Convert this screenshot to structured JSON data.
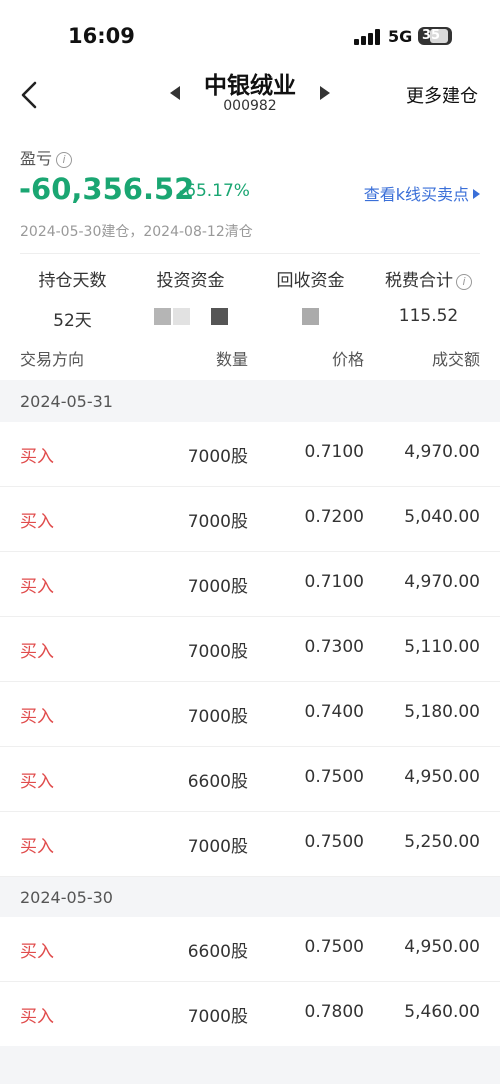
{
  "status_bar": {
    "time": "16:09",
    "network": "5G",
    "battery": "35"
  },
  "header": {
    "title": "中银绒业",
    "code": "000982",
    "more_label": "更多建仓"
  },
  "summary": {
    "pnl_label": "盈亏",
    "pnl_value": "-60,356.52",
    "pnl_pct": "-65.17%",
    "kline_link": "查看k线买卖点",
    "date_range": "2024-05-30建仓，2024-08-12清仓"
  },
  "stats": {
    "hold_days_label": "持仓天数",
    "hold_days_value": "52天",
    "invest_label": "投资资金",
    "recover_label": "回收资金",
    "fees_label": "税费合计",
    "fees_value": "115.52"
  },
  "table": {
    "headers": {
      "direction": "交易方向",
      "quantity": "数量",
      "price": "价格",
      "amount": "成交额"
    },
    "groups": [
      {
        "date": "2024-05-31",
        "rows": [
          {
            "direction": "买入",
            "quantity": "7000股",
            "price": "0.7100",
            "amount": "4,970.00"
          },
          {
            "direction": "买入",
            "quantity": "7000股",
            "price": "0.7200",
            "amount": "5,040.00"
          },
          {
            "direction": "买入",
            "quantity": "7000股",
            "price": "0.7100",
            "amount": "4,970.00"
          },
          {
            "direction": "买入",
            "quantity": "7000股",
            "price": "0.7300",
            "amount": "5,110.00"
          },
          {
            "direction": "买入",
            "quantity": "7000股",
            "price": "0.7400",
            "amount": "5,180.00"
          },
          {
            "direction": "买入",
            "quantity": "6600股",
            "price": "0.7500",
            "amount": "4,950.00"
          },
          {
            "direction": "买入",
            "quantity": "7000股",
            "price": "0.7500",
            "amount": "5,250.00"
          }
        ]
      },
      {
        "date": "2024-05-30",
        "rows": [
          {
            "direction": "买入",
            "quantity": "6600股",
            "price": "0.7500",
            "amount": "4,950.00"
          },
          {
            "direction": "买入",
            "quantity": "7000股",
            "price": "0.7800",
            "amount": "5,460.00"
          }
        ]
      }
    ]
  },
  "colors": {
    "loss": "#1aa672",
    "buy": "#e04b4b",
    "link": "#3a6fd8"
  }
}
